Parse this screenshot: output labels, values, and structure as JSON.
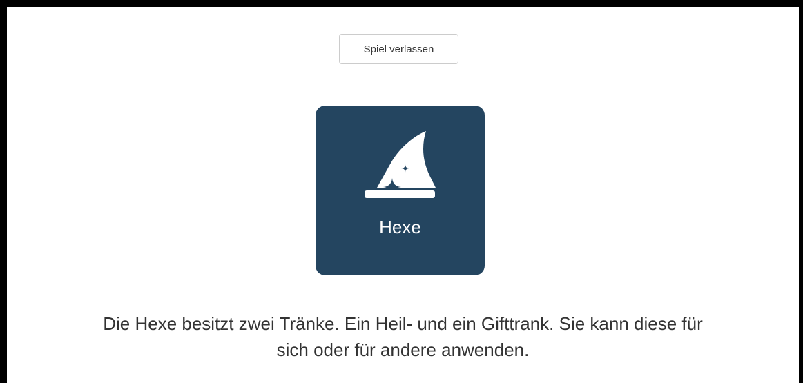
{
  "header": {
    "leave_button_label": "Spiel verlassen"
  },
  "role_card": {
    "icon": "witch-hat-icon",
    "name": "Hexe"
  },
  "description": {
    "line1": "Die Hexe besitzt zwei Tränke. Ein Heil- und ein Gifttrank. Sie kann diese für",
    "line2": "sich oder für andere anwenden."
  },
  "colors": {
    "card_background": "#244560",
    "card_text": "#ffffff",
    "page_background": "#ffffff",
    "border": "#000000",
    "body_text": "#333333"
  }
}
